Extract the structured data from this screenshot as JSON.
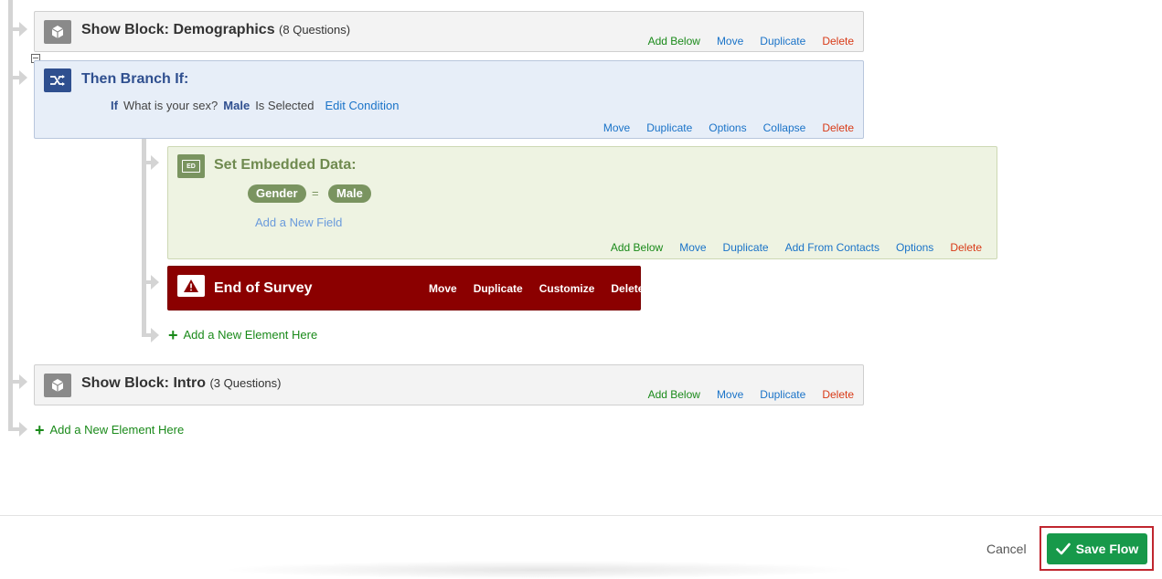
{
  "blocks": {
    "demographics": {
      "title": "Show Block: Demographics",
      "count": "(8 Questions)",
      "actions": {
        "add_below": "Add Below",
        "move": "Move",
        "duplicate": "Duplicate",
        "delete": "Delete"
      }
    },
    "branch": {
      "title": "Then Branch If:",
      "condition": {
        "if_label": "If",
        "question": "What is your sex?",
        "value": "Male",
        "operator": "Is Selected",
        "edit_label": "Edit Condition"
      },
      "actions": {
        "move": "Move",
        "duplicate": "Duplicate",
        "options": "Options",
        "collapse": "Collapse",
        "delete": "Delete"
      }
    },
    "embedded": {
      "icon_label": "ED",
      "title": "Set Embedded Data:",
      "field_name": "Gender",
      "equals": "=",
      "field_value": "Male",
      "add_field": "Add a New Field",
      "actions": {
        "add_below": "Add Below",
        "move": "Move",
        "duplicate": "Duplicate",
        "add_from_contacts": "Add From Contacts",
        "options": "Options",
        "delete": "Delete"
      }
    },
    "end_survey": {
      "title": "End of Survey",
      "actions": {
        "move": "Move",
        "duplicate": "Duplicate",
        "customize": "Customize",
        "delete": "Delete"
      }
    },
    "add_inner": "Add a New Element Here",
    "intro": {
      "title": "Show Block: Intro",
      "count": "(3 Questions)",
      "actions": {
        "add_below": "Add Below",
        "move": "Move",
        "duplicate": "Duplicate",
        "delete": "Delete"
      }
    },
    "add_outer": "Add a New Element Here"
  },
  "footer": {
    "cancel": "Cancel",
    "save": "Save Flow"
  },
  "colors": {
    "branch_title": "#2f4f8f",
    "embedded_title": "#6f8a4f",
    "save_green": "#17994a",
    "end_red": "#8b0000"
  }
}
